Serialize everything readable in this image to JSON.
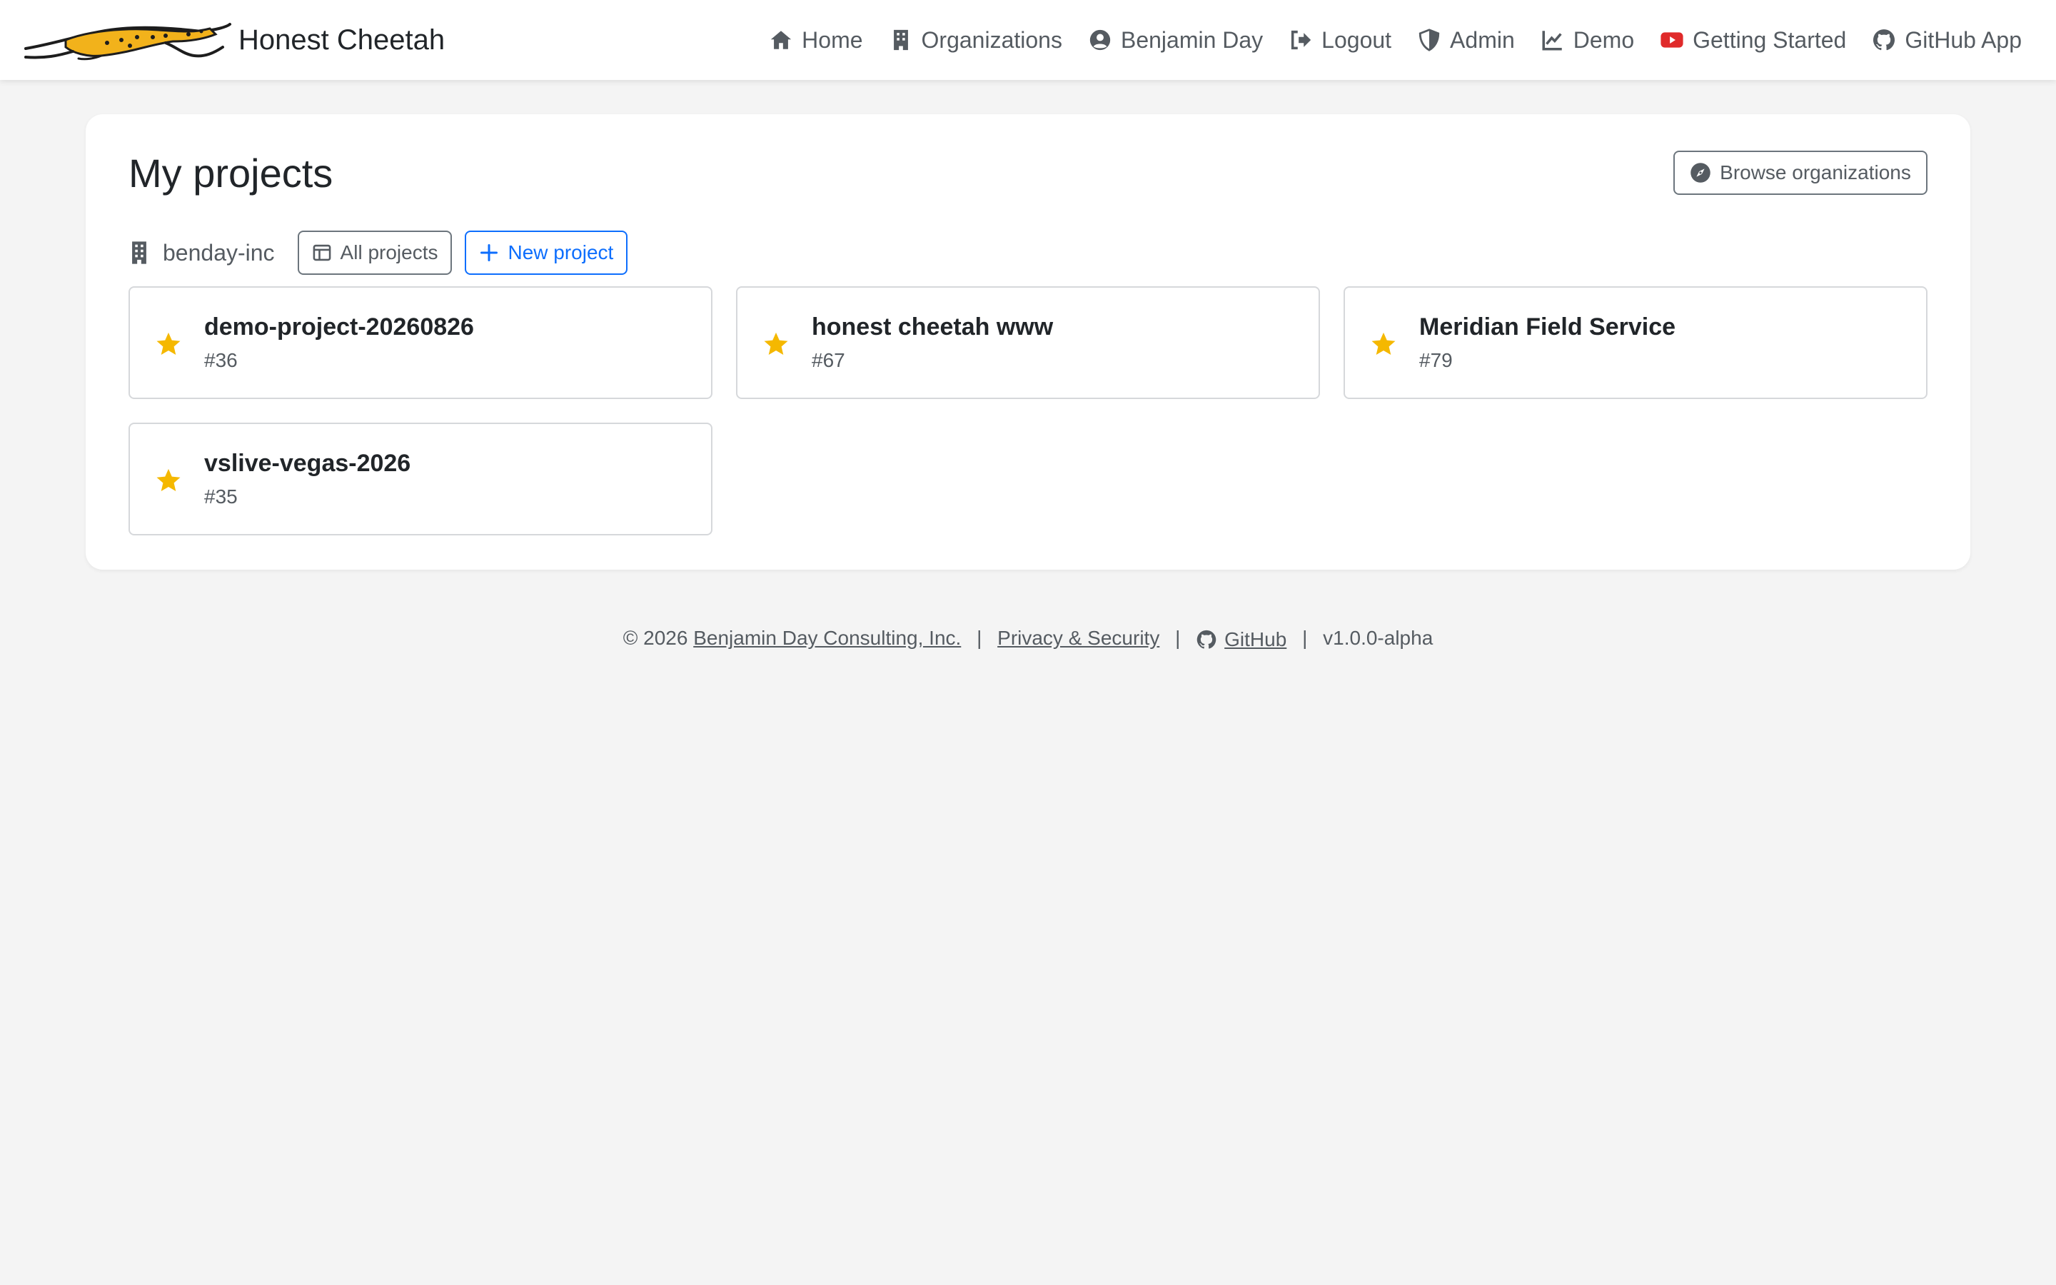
{
  "app": {
    "brand": "Honest Cheetah"
  },
  "nav": {
    "items": [
      {
        "label": "Home",
        "icon": "home-icon"
      },
      {
        "label": "Organizations",
        "icon": "building-icon"
      },
      {
        "label": "Benjamin Day",
        "icon": "user-circle-icon"
      },
      {
        "label": "Logout",
        "icon": "logout-icon"
      },
      {
        "label": "Admin",
        "icon": "shield-icon"
      },
      {
        "label": "Demo",
        "icon": "chart-line-icon"
      },
      {
        "label": "Getting Started",
        "icon": "youtube-icon"
      },
      {
        "label": "GitHub App",
        "icon": "github-icon"
      }
    ]
  },
  "main": {
    "title": "My projects",
    "browse_label": "Browse organizations",
    "org": {
      "name": "benday-inc",
      "all_projects_label": "All projects",
      "new_project_label": "New project"
    },
    "projects": [
      {
        "name": "demo-project-20260826",
        "number": "#36",
        "starred": true
      },
      {
        "name": "honest cheetah www",
        "number": "#67",
        "starred": true
      },
      {
        "name": "Meridian Field Service",
        "number": "#79",
        "starred": true
      },
      {
        "name": "vslive-vegas-2026",
        "number": "#35",
        "starred": true
      }
    ]
  },
  "footer": {
    "copyright": "© 2026",
    "company": "Benjamin Day Consulting, Inc.",
    "privacy": "Privacy & Security",
    "github": "GitHub",
    "version": "v1.0.0-alpha"
  },
  "colors": {
    "accent": "#0d6efd",
    "star": "#f5b800",
    "youtube": "#e02a2a",
    "background": "#f4f4f4"
  }
}
